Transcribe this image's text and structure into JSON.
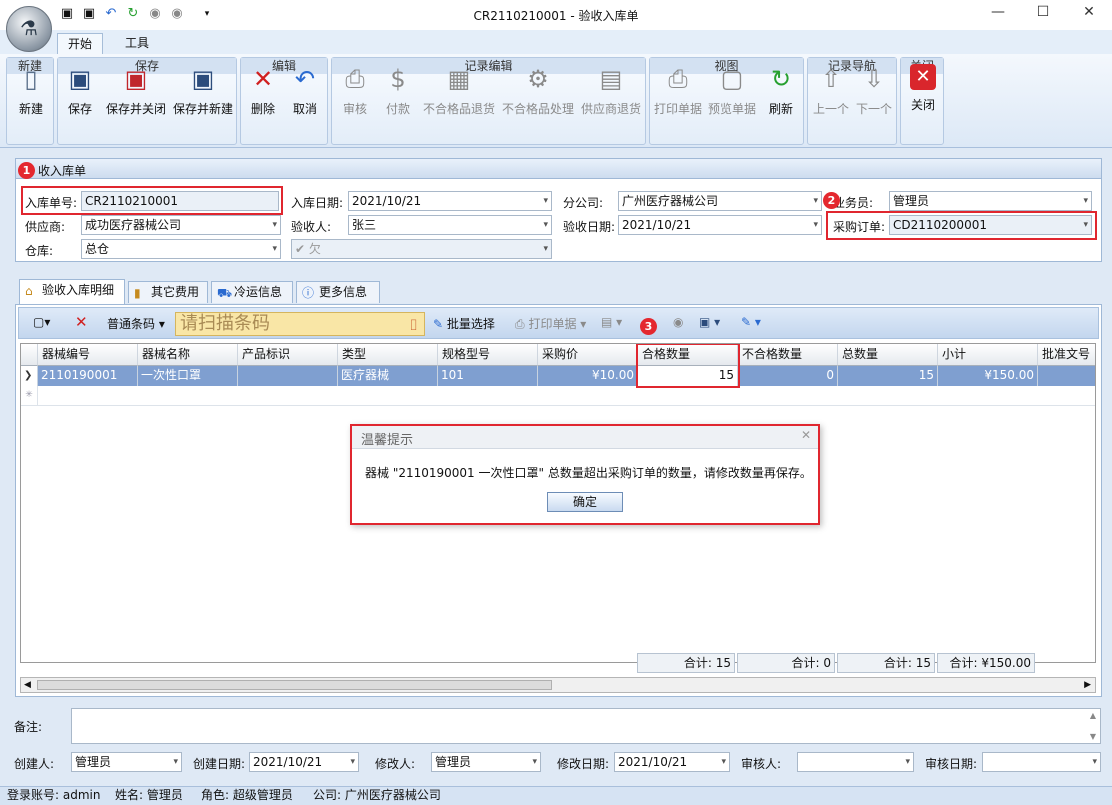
{
  "window": {
    "title": "CR2110210001 - 验收入库单"
  },
  "ribbon": {
    "tabs": [
      {
        "label": "开始"
      },
      {
        "label": "工具"
      }
    ],
    "groups": [
      {
        "caption": "新建",
        "buttons": [
          {
            "label": "新建"
          }
        ]
      },
      {
        "caption": "保存",
        "buttons": [
          {
            "label": "保存"
          },
          {
            "label": "保存并关闭"
          },
          {
            "label": "保存并新建"
          }
        ]
      },
      {
        "caption": "编辑",
        "buttons": [
          {
            "label": "删除"
          },
          {
            "label": "取消"
          }
        ]
      },
      {
        "caption": "记录编辑",
        "buttons": [
          {
            "label": "审核"
          },
          {
            "label": "付款"
          },
          {
            "label": "不合格品退货"
          },
          {
            "label": "不合格品处理"
          },
          {
            "label": "供应商退货"
          }
        ]
      },
      {
        "caption": "视图",
        "buttons": [
          {
            "label": "打印单据"
          },
          {
            "label": "预览单据"
          },
          {
            "label": "刷新"
          }
        ]
      },
      {
        "caption": "记录导航",
        "buttons": [
          {
            "label": "上一个"
          },
          {
            "label": "下一个"
          }
        ]
      },
      {
        "caption": "关闭",
        "buttons": [
          {
            "label": "关闭"
          }
        ]
      }
    ]
  },
  "form": {
    "title": "收入库单",
    "fields": {
      "order_no": {
        "label": "入库单号:",
        "value": "CR2110210001"
      },
      "in_date": {
        "label": "入库日期:",
        "value": "2021/10/21"
      },
      "branch": {
        "label": "分公司:",
        "value": "广州医疗器械公司"
      },
      "salesman": {
        "label": "业务员:",
        "value": "管理员"
      },
      "supplier": {
        "label": "供应商:",
        "value": "成功医疗器械公司"
      },
      "inspector": {
        "label": "验收人:",
        "value": "张三"
      },
      "inspect_date": {
        "label": "验收日期:",
        "value": "2021/10/21"
      },
      "po": {
        "label": "采购订单:",
        "value": "CD2110200001"
      },
      "warehouse": {
        "label": "仓库:",
        "value": "总仓"
      },
      "debt": {
        "value": "欠"
      }
    },
    "badges": [
      "1",
      "2",
      "3"
    ]
  },
  "detail_tabs": [
    {
      "label": "验收入库明细"
    },
    {
      "label": "其它费用"
    },
    {
      "label": "冷运信息"
    },
    {
      "label": "更多信息"
    }
  ],
  "grid_toolbar": {
    "barcode_mode": "普通条码",
    "scan_placeholder": "请扫描条码",
    "batch_select": "批量选择",
    "print": "打印单据"
  },
  "grid": {
    "columns": [
      "器械编号",
      "器械名称",
      "产品标识",
      "类型",
      "规格型号",
      "采购价",
      "合格数量",
      "不合格数量",
      "总数量",
      "小计",
      "批准文号"
    ],
    "rows": [
      [
        "2110190001",
        "一次性口罩",
        "",
        "医疗器械",
        "101",
        "¥10.00",
        "15",
        "0",
        "15",
        "¥150.00",
        ""
      ]
    ],
    "footer": [
      "合计: 15",
      "合计: 0",
      "合计: 15",
      "合计: ¥150.00"
    ]
  },
  "dialog": {
    "title": "温馨提示",
    "message": "器械 \"2110190001 一次性口罩\" 总数量超出采购订单的数量，请修改数量再保存。",
    "ok": "确定"
  },
  "bottom": {
    "remarks_label": "备注:",
    "creator": {
      "label": "创建人:",
      "value": "管理员"
    },
    "create_date": {
      "label": "创建日期:",
      "value": "2021/10/21"
    },
    "modifier": {
      "label": "修改人:",
      "value": "管理员"
    },
    "modify_date": {
      "label": "修改日期:",
      "value": "2021/10/21"
    },
    "auditor": {
      "label": "审核人:",
      "value": ""
    },
    "audit_date": {
      "label": "审核日期:",
      "value": ""
    }
  },
  "status": {
    "account": "登录账号: admin",
    "name": "姓名: 管理员",
    "role": "角色: 超级管理员",
    "company": "公司: 广州医疗器械公司"
  },
  "colors": {
    "highlight_red": "#e0262f",
    "selected_row": "#7f9fd0"
  }
}
